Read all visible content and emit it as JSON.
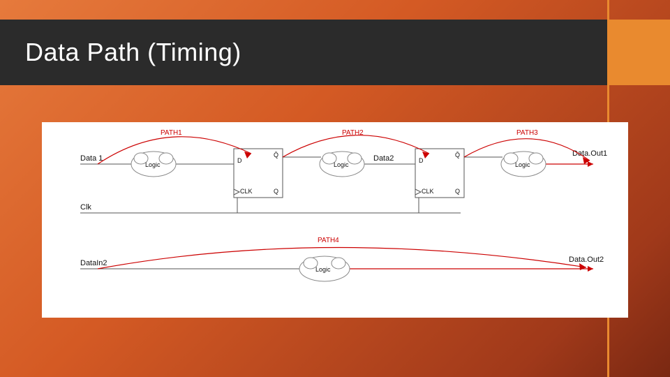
{
  "title": "Data Path (Timing)",
  "paths": {
    "p1": "PATH1",
    "p2": "PATH2",
    "p3": "PATH3",
    "p4": "PATH4"
  },
  "signals": {
    "in1": "Data 1",
    "clk": "Clk",
    "in2": "DataIn2",
    "mid": "Data2",
    "out1": "Data.Out1",
    "out2": "Data.Out2"
  },
  "blocks": {
    "logic": "Logic"
  },
  "pins": {
    "d": "D",
    "q": "Q",
    "qb": "Q̄",
    "clk": "CLK"
  }
}
